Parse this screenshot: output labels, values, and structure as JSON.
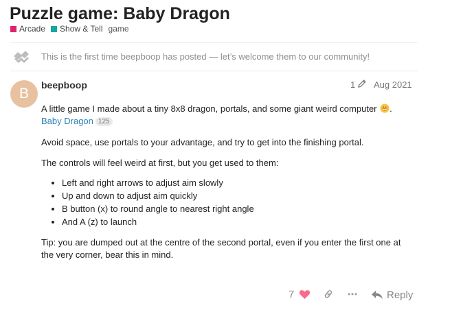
{
  "topic": {
    "title": "Puzzle game: Baby Dragon",
    "categories": [
      {
        "name": "Arcade",
        "color": "#e0246b"
      },
      {
        "name": "Show & Tell",
        "color": "#12a89d"
      }
    ],
    "tags": [
      "game"
    ]
  },
  "notice": {
    "icon": "welcome-hands-icon",
    "text": "This is the first time beepboop has posted — let’s welcome them to our community!"
  },
  "post": {
    "avatar_letter": "B",
    "avatar_color": "#e8c1a0",
    "username": "beepboop",
    "edit_count": "1",
    "date": "Aug 2021",
    "intro": "A little game I made about a tiny 8x8 dragon, portals, and some giant weird computer",
    "intro_end": ".",
    "emoji": "grinning-face-emoji",
    "link_text": "Baby Dragon",
    "link_clicks": "125",
    "paragraph_space": "Avoid space, use portals to your advantage, and try to get into the finishing portal.",
    "paragraph_controls": "The controls will feel weird at first, but you get used to them:",
    "controls": [
      "Left and right arrows to adjust aim slowly",
      "Up and down to adjust aim quickly",
      "B button (x) to round angle to nearest right angle",
      "And A (z) to launch"
    ],
    "tip": "Tip: you are dumped out at the centre of the second portal, even if you enter the first one at the very corner, bear this in mind."
  },
  "actions": {
    "like_count": "7",
    "like_color": "#fa6c8d",
    "reply_label": "Reply"
  }
}
